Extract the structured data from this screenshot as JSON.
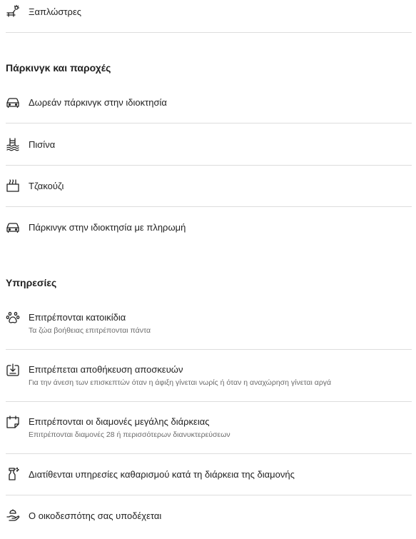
{
  "top_items": [
    {
      "label": "Ξαπλώστρες",
      "icon": "sunbed-icon"
    }
  ],
  "parking": {
    "heading": "Πάρκινγκ και παροχές",
    "items": [
      {
        "label": "Δωρεάν πάρκινγκ στην ιδιοκτησία",
        "icon": "car-icon"
      },
      {
        "label": "Πισίνα",
        "icon": "pool-icon"
      },
      {
        "label": "Τζακούζι",
        "icon": "hot-tub-icon"
      },
      {
        "label": "Πάρκινγκ στην ιδιοκτησία με πληρωμή",
        "icon": "car-icon"
      }
    ]
  },
  "services": {
    "heading": "Υπηρεσίες",
    "items": [
      {
        "label": "Επιτρέπονται κατοικίδια",
        "sub": "Τα ζώα βοήθειας επιτρέπονται πάντα",
        "icon": "paw-icon"
      },
      {
        "label": "Επιτρέπεται αποθήκευση αποσκευών",
        "sub": "Για την άνεση των επισκεπτών όταν η άφιξη γίνεται νωρίς ή όταν η αναχώρηση γίνεται αργά",
        "icon": "luggage-icon"
      },
      {
        "label": "Επιτρέπονται οι διαμονές μεγάλης διάρκειας",
        "sub": "Επιτρέπονται διαμονές 28 ή περισσότερων διανυκτερεύσεων",
        "icon": "calendar-icon"
      },
      {
        "label": "Διατίθενται υπηρεσίες καθαρισμού κατά τη διάρκεια της διαμονής",
        "icon": "spray-bottle-icon"
      },
      {
        "label": "Ο οικοδεσπότης σας υποδέχεται",
        "icon": "hand-icon"
      }
    ]
  }
}
